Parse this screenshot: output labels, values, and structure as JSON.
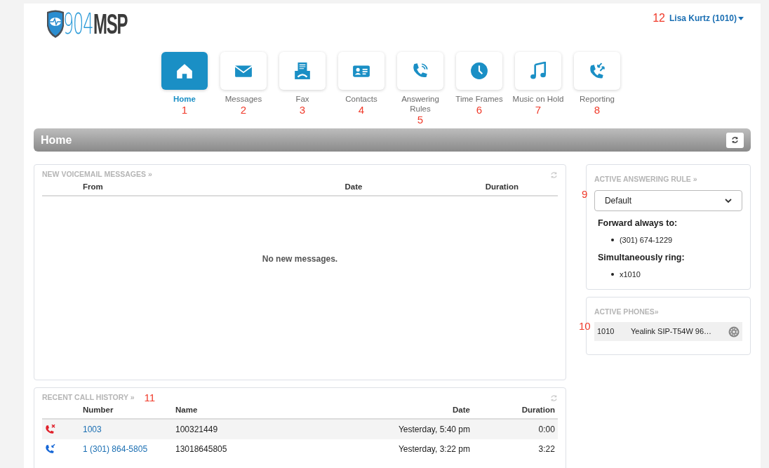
{
  "logo": {
    "text_light": "904",
    "text_dark": "MSP"
  },
  "user_menu": {
    "label": "Lisa Kurtz (1010)",
    "marker": "12"
  },
  "nav": [
    {
      "label": "Home",
      "selected": true,
      "marker": "1"
    },
    {
      "label": "Messages",
      "selected": false,
      "marker": "2"
    },
    {
      "label": "Fax",
      "selected": false,
      "marker": "3"
    },
    {
      "label": "Contacts",
      "selected": false,
      "marker": "4"
    },
    {
      "label": "Answering Rules",
      "selected": false,
      "marker": "5"
    },
    {
      "label": "Time Frames",
      "selected": false,
      "marker": "6"
    },
    {
      "label": "Music on Hold",
      "selected": false,
      "marker": "7"
    },
    {
      "label": "Reporting",
      "selected": false,
      "marker": "8"
    }
  ],
  "page_title": "Home",
  "voicemail": {
    "title": "NEW VOICEMAIL MESSAGES »",
    "columns": [
      "From",
      "Date",
      "Duration"
    ],
    "empty_text": "No new messages."
  },
  "answering_rule": {
    "title": "ACTIVE ANSWERING RULE »",
    "marker": "9",
    "select_value": "Default",
    "sections": [
      {
        "heading": "Forward always to:",
        "items": [
          "(301) 674-1229"
        ]
      },
      {
        "heading": "Simultaneously ring:",
        "items": [
          "x1010"
        ]
      }
    ]
  },
  "active_phones": {
    "title": "ACTIVE PHONES»",
    "marker": "10",
    "rows": [
      {
        "extension": "1010",
        "device": "Yealink SIP-T54W 96…"
      }
    ]
  },
  "call_history": {
    "title": "RECENT CALL HISTORY »",
    "marker": "11",
    "columns": [
      "Number",
      "Name",
      "Date",
      "Duration"
    ],
    "rows": [
      {
        "kind": "missed",
        "number": "1003",
        "name": "100321449",
        "date": "Yesterday, 5:40 pm",
        "duration": "0:00"
      },
      {
        "kind": "incoming",
        "number": "1 (301) 864-5805",
        "name": "13018645805",
        "date": "Yesterday, 3:22 pm",
        "duration": "3:22"
      }
    ]
  }
}
